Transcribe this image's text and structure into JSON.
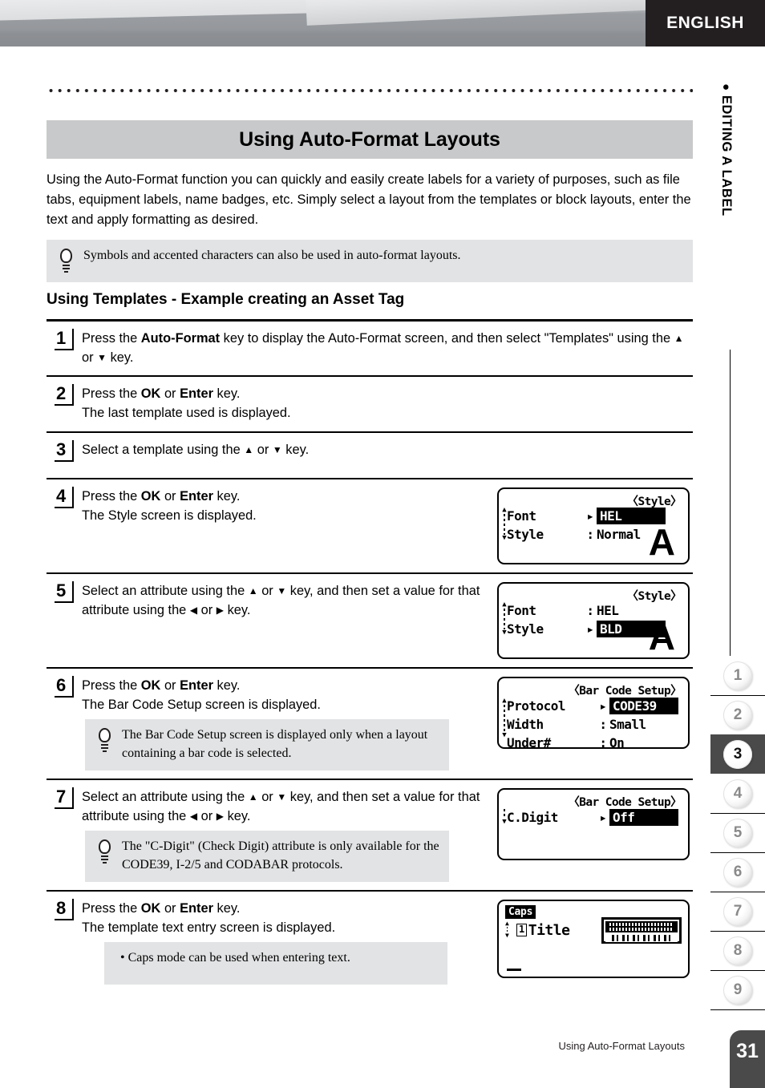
{
  "header": {
    "language_badge": "ENGLISH"
  },
  "side_rail": {
    "chapter_label_bullet": "●",
    "chapter_label": "EDITING A LABEL",
    "tabs": [
      {
        "label": "1",
        "active": false
      },
      {
        "label": "2",
        "active": false
      },
      {
        "label": "3",
        "active": true
      },
      {
        "label": "4",
        "active": false
      },
      {
        "label": "5",
        "active": false
      },
      {
        "label": "6",
        "active": false
      },
      {
        "label": "7",
        "active": false
      },
      {
        "label": "8",
        "active": false
      },
      {
        "label": "9",
        "active": false
      }
    ]
  },
  "page_title": "Using Auto-Format Layouts",
  "intro_paragraph": "Using the Auto-Format function you can quickly and easily create labels for a variety of purposes, such as file tabs, equipment labels, name badges, etc. Simply select a layout from the templates or block layouts, enter the text and apply formatting as desired.",
  "intro_tip": "Symbols and accented characters can also be used in auto-format layouts.",
  "subheading": "Using Templates - Example creating an Asset Tag",
  "steps": [
    {
      "number": "1",
      "text_parts": [
        {
          "t": "Press the ",
          "b": false
        },
        {
          "t": "Auto-Format",
          "b": true
        },
        {
          "t": " key to display the Auto-Format screen, and then select \"Templates\" using the ",
          "b": false
        },
        {
          "t": "▲",
          "b": false,
          "arrow": true
        },
        {
          "t": " or ",
          "b": false
        },
        {
          "t": "▼",
          "b": false,
          "arrow": true
        },
        {
          "t": " key.",
          "b": false
        }
      ]
    },
    {
      "number": "2",
      "text_parts": [
        {
          "t": "Press the ",
          "b": false
        },
        {
          "t": "OK",
          "b": true
        },
        {
          "t": " or ",
          "b": false
        },
        {
          "t": "Enter",
          "b": true
        },
        {
          "t": " key.",
          "b": false
        },
        {
          "t": "\n",
          "b": false,
          "br": true
        },
        {
          "t": "The last template used is displayed.",
          "b": false
        }
      ]
    },
    {
      "number": "3",
      "text_parts": [
        {
          "t": "Select a template using the ",
          "b": false
        },
        {
          "t": "▲",
          "b": false,
          "arrow": true
        },
        {
          "t": " or ",
          "b": false
        },
        {
          "t": "▼",
          "b": false,
          "arrow": true
        },
        {
          "t": " key.",
          "b": false
        }
      ]
    },
    {
      "number": "4",
      "text_parts": [
        {
          "t": "Press the ",
          "b": false
        },
        {
          "t": "OK",
          "b": true
        },
        {
          "t": " or ",
          "b": false
        },
        {
          "t": "Enter",
          "b": true
        },
        {
          "t": " key.",
          "b": false
        },
        {
          "t": "\n",
          "b": false,
          "br": true
        },
        {
          "t": "The Style screen is displayed.",
          "b": false
        }
      ]
    },
    {
      "number": "5",
      "text_parts": [
        {
          "t": "Select an attribute using the ",
          "b": false
        },
        {
          "t": "▲",
          "b": false,
          "arrow": true
        },
        {
          "t": " or ",
          "b": false
        },
        {
          "t": "▼",
          "b": false,
          "arrow": true
        },
        {
          "t": " key, and then set a value for that attribute using the ",
          "b": false
        },
        {
          "t": "◀",
          "b": false,
          "arrow": true
        },
        {
          "t": " or ",
          "b": false
        },
        {
          "t": "▶",
          "b": false,
          "arrow": true
        },
        {
          "t": " key.",
          "b": false
        }
      ]
    },
    {
      "number": "6",
      "text_parts": [
        {
          "t": "Press the ",
          "b": false
        },
        {
          "t": "OK",
          "b": true
        },
        {
          "t": " or ",
          "b": false
        },
        {
          "t": "Enter",
          "b": true
        },
        {
          "t": " key.",
          "b": false
        },
        {
          "t": "\n",
          "b": false,
          "br": true
        },
        {
          "t": "The Bar Code Setup screen is displayed.",
          "b": false
        }
      ],
      "tip": "The Bar Code Setup screen is displayed only when a layout containing a bar code is selected."
    },
    {
      "number": "7",
      "text_parts": [
        {
          "t": "Select an attribute using the ",
          "b": false
        },
        {
          "t": "▲",
          "b": false,
          "arrow": true
        },
        {
          "t": " or ",
          "b": false
        },
        {
          "t": "▼",
          "b": false,
          "arrow": true
        },
        {
          "t": " key, and then set a value for that attribute using the ",
          "b": false
        },
        {
          "t": "◀",
          "b": false,
          "arrow": true
        },
        {
          "t": " or ",
          "b": false
        },
        {
          "t": "▶",
          "b": false,
          "arrow": true
        },
        {
          "t": " key.",
          "b": false
        }
      ],
      "tip": "The \"C-Digit\" (Check Digit) attribute is only available for the CODE39, I-2/5 and CODABAR protocols."
    },
    {
      "number": "8",
      "text_parts": [
        {
          "t": "Press the ",
          "b": false
        },
        {
          "t": "OK",
          "b": true
        },
        {
          "t": " or ",
          "b": false
        },
        {
          "t": "Enter",
          "b": true
        },
        {
          "t": " key.",
          "b": false
        },
        {
          "t": "\n",
          "b": false,
          "br": true
        },
        {
          "t": "The template text entry screen is displayed.",
          "b": false
        }
      ],
      "tip": "• Caps mode can be used when entering text."
    }
  ],
  "lcd_screens": {
    "style_font": {
      "title": "〈Style〉",
      "rows": [
        {
          "label": "Font",
          "sep": "▸",
          "value": "HEL",
          "inverted": true
        },
        {
          "label": "Style",
          "sep": ":",
          "value": "Normal",
          "inverted": false
        }
      ],
      "big_glyph": "A"
    },
    "style_bold": {
      "title": "〈Style〉",
      "rows": [
        {
          "label": "Font",
          "sep": ":",
          "value": "HEL",
          "inverted": false
        },
        {
          "label": "Style",
          "sep": "▸",
          "value": "BLD",
          "inverted": true
        }
      ],
      "big_glyph": "A"
    },
    "barcode_setup": {
      "title": "〈Bar Code Setup〉",
      "rows": [
        {
          "label": "Protocol",
          "sep": "▸",
          "value": "CODE39",
          "inverted": true
        },
        {
          "label": "Width",
          "sep": ":",
          "value": "Small",
          "inverted": false
        },
        {
          "label": "Under#",
          "sep": ":",
          "value": "On",
          "inverted": false
        }
      ]
    },
    "barcode_cdigit": {
      "title": "〈Bar Code Setup〉",
      "rows": [
        {
          "label": "C.Digit",
          "sep": "▸",
          "value": "Off",
          "inverted": true
        }
      ]
    },
    "text_entry": {
      "caps_badge": "Caps",
      "block_number": "1",
      "field_label": "Title"
    }
  },
  "footer": {
    "running_title": "Using Auto-Format Layouts",
    "page_number": "31"
  },
  "colors": {
    "header_band": "#8a8d91",
    "badge_dark": "#231f20",
    "title_bar_gray": "#c8c9ca",
    "tip_gray": "#e2e3e4",
    "tab_active": "#4a4a4a"
  }
}
